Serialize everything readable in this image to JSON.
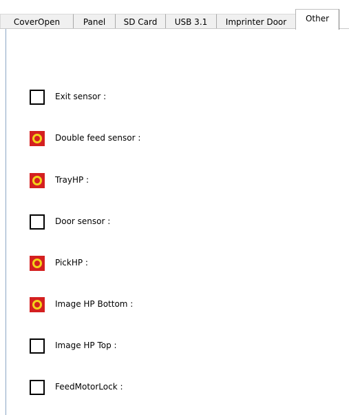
{
  "tabs": [
    {
      "label": "CoverOpen",
      "active": false
    },
    {
      "label": "Panel",
      "active": false
    },
    {
      "label": "SD Card",
      "active": false
    },
    {
      "label": "USB 3.1",
      "active": false
    },
    {
      "label": "Imprinter Door",
      "active": false
    },
    {
      "label": "Other",
      "active": true
    }
  ],
  "sensors": [
    {
      "label": "Exit sensor :",
      "state": "off"
    },
    {
      "label": "Double feed sensor :",
      "state": "on"
    },
    {
      "label": "TrayHP :",
      "state": "on"
    },
    {
      "label": "Door sensor :",
      "state": "off"
    },
    {
      "label": "PickHP :",
      "state": "on"
    },
    {
      "label": "Image HP Bottom :",
      "state": "on"
    },
    {
      "label": "Image HP Top :",
      "state": "off"
    },
    {
      "label": "FeedMotorLock :",
      "state": "off"
    }
  ],
  "colors": {
    "indicator_on_fill": "#d42020",
    "indicator_on_ring": "#f2d21a",
    "indicator_off_border": "#000000"
  }
}
